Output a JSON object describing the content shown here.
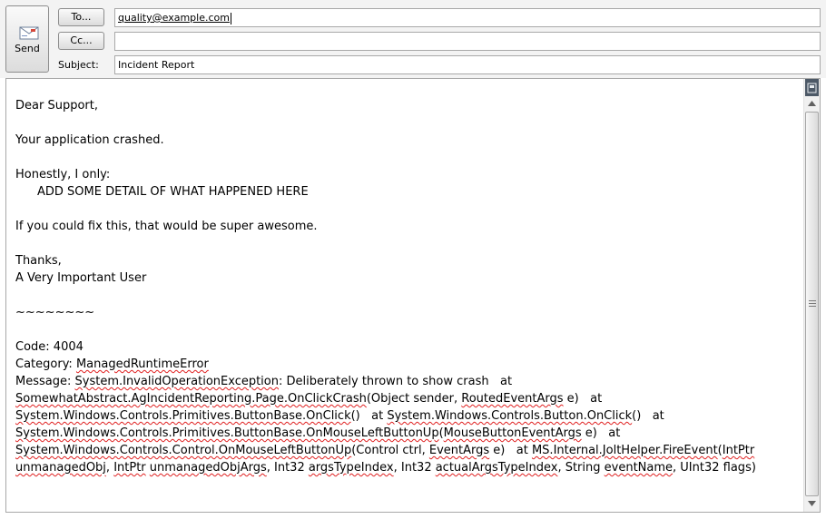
{
  "header": {
    "send_label": "Send",
    "to_label": "To...",
    "cc_label": "Cc...",
    "subject_label": "Subject:",
    "to_value": "quality@example.com",
    "cc_value": "",
    "subject_value": "Incident Report"
  },
  "body": {
    "greeting": "Dear Support,",
    "crash_line": "Your application crashed.",
    "honest_line": "Honestly, I only:",
    "detail_placeholder": "ADD SOME DETAIL OF WHAT HAPPENED HERE",
    "fix_line": "If you could fix this, that would be super awesome.",
    "thanks": "Thanks,",
    "signature": "A Very Important User",
    "separator": "~~~~~~~~",
    "code": "Code: 4004",
    "category_label": "Category: ",
    "category_value": "ManagedRuntimeError",
    "message_lines": [
      [
        {
          "t": "Message: ",
          "s": false
        },
        {
          "t": "System.InvalidOperationException",
          "s": true
        },
        {
          "t": ": Deliberately thrown to show crash   at",
          "s": false
        }
      ],
      [
        {
          "t": "SomewhatAbstract.AgIncidentReporting.Page.OnClickCrash",
          "s": true
        },
        {
          "t": "(Object sender, ",
          "s": false
        },
        {
          "t": "RoutedEventArgs",
          "s": true
        },
        {
          "t": " e)   at",
          "s": false
        }
      ],
      [
        {
          "t": "System.Windows.Controls.Primitives.ButtonBase.OnClick",
          "s": true
        },
        {
          "t": "()   at ",
          "s": false
        },
        {
          "t": "System.Windows.Controls.Button.OnClick",
          "s": true
        },
        {
          "t": "()   at",
          "s": false
        }
      ],
      [
        {
          "t": "System.Windows.Controls.Primitives.ButtonBase.OnMouseLeftButtonUp",
          "s": true
        },
        {
          "t": "(",
          "s": false
        },
        {
          "t": "MouseButtonEventArgs",
          "s": true
        },
        {
          "t": " e)   at",
          "s": false
        }
      ],
      [
        {
          "t": "System.Windows.Controls.Control.OnMouseLeftButtonUp",
          "s": true
        },
        {
          "t": "(Control ctrl, ",
          "s": false
        },
        {
          "t": "EventArgs",
          "s": true
        },
        {
          "t": " e)   at ",
          "s": false
        },
        {
          "t": "MS.Internal.JoltHelper.FireEvent",
          "s": true
        },
        {
          "t": "(",
          "s": false
        },
        {
          "t": "IntPtr",
          "s": true
        }
      ],
      [
        {
          "t": "unmanagedObj",
          "s": true
        },
        {
          "t": ", ",
          "s": false
        },
        {
          "t": "IntPtr",
          "s": true
        },
        {
          "t": " ",
          "s": false
        },
        {
          "t": "unmanagedObjArgs",
          "s": true
        },
        {
          "t": ", Int32 ",
          "s": false
        },
        {
          "t": "argsTypeIndex",
          "s": true
        },
        {
          "t": ", Int32 ",
          "s": false
        },
        {
          "t": "actualArgsTypeIndex",
          "s": true
        },
        {
          "t": ", String ",
          "s": false
        },
        {
          "t": "eventName",
          "s": true
        },
        {
          "t": ", UInt32 flags)",
          "s": false
        }
      ]
    ]
  },
  "icons": {
    "send": "envelope-icon",
    "scroll_top": "split-view-icon",
    "scroll_up": "triangle-up-icon",
    "scroll_down": "triangle-down-icon"
  },
  "colors": {
    "spellcheck": "#e02020",
    "header_bg": "#f3f3f3"
  }
}
